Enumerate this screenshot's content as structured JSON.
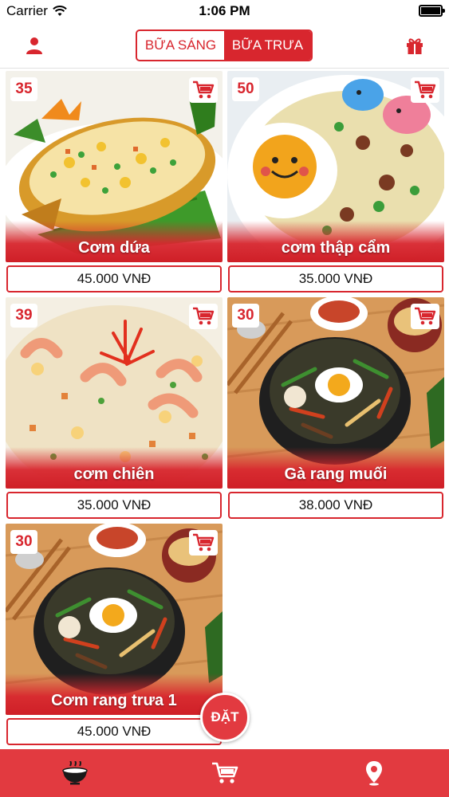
{
  "status_bar": {
    "carrier": "Carrier",
    "time": "1:06 PM"
  },
  "header": {
    "tabs": [
      {
        "label": "BỮA SÁNG",
        "active": false
      },
      {
        "label": "BỮA TRƯA",
        "active": true
      }
    ],
    "left_icon": "user-icon",
    "right_icon": "gift-icon"
  },
  "items": [
    {
      "name": "Cơm dứa",
      "count": "35",
      "price": "45.000 VNĐ",
      "image": "pineapple-rice"
    },
    {
      "name": "cơm thập cẩm",
      "count": "50",
      "price": "35.000 VNĐ",
      "image": "mixed-fried-rice-egg"
    },
    {
      "name": "cơm chiên",
      "count": "39",
      "price": "35.000 VNĐ",
      "image": "shrimp-fried-rice"
    },
    {
      "name": "Gà rang muối",
      "count": "30",
      "price": "38.000 VNĐ",
      "image": "bibimbap-bowl"
    },
    {
      "name": "Cơm rang trưa 1",
      "count": "30",
      "price": "45.000 VNĐ",
      "image": "bibimbap-bowl"
    }
  ],
  "order_button": {
    "label": "ĐẶT"
  },
  "tabbar": {
    "icons": [
      "food-bowl-icon",
      "cart-icon",
      "location-pin-icon"
    ]
  },
  "colors": {
    "accent": "#d8262e",
    "tabbar": "#e23a40"
  }
}
